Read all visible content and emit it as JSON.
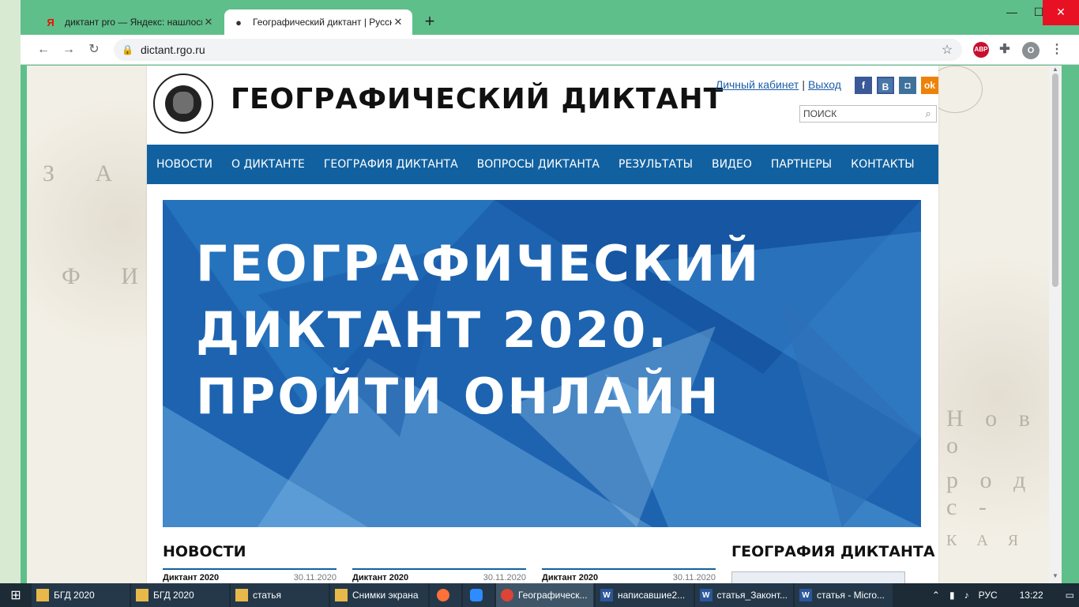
{
  "browser": {
    "tabs": [
      {
        "favicon": "Я",
        "title": "диктант pro — Яндекс: нашлось",
        "active": false
      },
      {
        "favicon": "●",
        "title": "Географический диктант | Русск",
        "active": true
      }
    ],
    "new_tab": "+",
    "url": "dictant.rgo.ru",
    "window_controls": {
      "minimize": "—",
      "maximize": "☐",
      "close": "✕"
    },
    "extensions": {
      "abp_badge": "ABP",
      "profile_initial": "O"
    }
  },
  "site": {
    "title": "ГЕОГРАФИЧЕСКИЙ ДИКТАНТ",
    "auth": {
      "cabinet": "Личный кабинет",
      "separator": "|",
      "logout": "Выход"
    },
    "social": {
      "fb": "f",
      "vk": "B",
      "ig": "◘",
      "ok": "ok"
    },
    "search_placeholder": "ПОИСК",
    "nav": [
      "НОВОСТИ",
      "О ДИКТАНТЕ",
      "ГЕОГРАФИЯ ДИКТАНТА",
      "ВОПРОСЫ ДИКТАНТА",
      "РЕЗУЛЬТАТЫ",
      "ВИДЕО",
      "ПАРТНЕРЫ",
      "КОНТАКТЫ"
    ],
    "banner_lines": [
      "ГЕОГРАФИЧЕСКИЙ",
      "ДИКТАНТ 2020.",
      "ПРОЙТИ ОНЛАЙН"
    ],
    "news_heading": "НОВОСТИ",
    "geo_heading": "ГЕОГРАФИЯ ДИКТАНТА",
    "news_cards": [
      {
        "title": "Диктант 2020",
        "date": "30.11.2020"
      },
      {
        "title": "Диктант 2020",
        "date": "30.11.2020"
      },
      {
        "title": "Диктант 2020",
        "date": "30.11.2020"
      }
    ],
    "map_words": [
      "З А Л",
      "Ф И",
      "Н о в о",
      "р о д с -",
      "К А Я"
    ]
  },
  "taskbar": {
    "items": [
      {
        "icon": "folder",
        "label": "БГД 2020"
      },
      {
        "icon": "folder",
        "label": "БГД 2020"
      },
      {
        "icon": "folder",
        "label": "статья"
      },
      {
        "icon": "folder",
        "label": "Снимки экрана"
      },
      {
        "icon": "firefox",
        "label": ""
      },
      {
        "icon": "zoom",
        "label": ""
      },
      {
        "icon": "chrome",
        "label": "Географическ...",
        "active": true
      },
      {
        "icon": "word",
        "label": "написавшие2..."
      },
      {
        "icon": "word",
        "label": "статья_Законт..."
      },
      {
        "icon": "word",
        "label": "статья - Micro..."
      }
    ],
    "tray": {
      "lang": "РУС",
      "time": "13:22"
    }
  }
}
